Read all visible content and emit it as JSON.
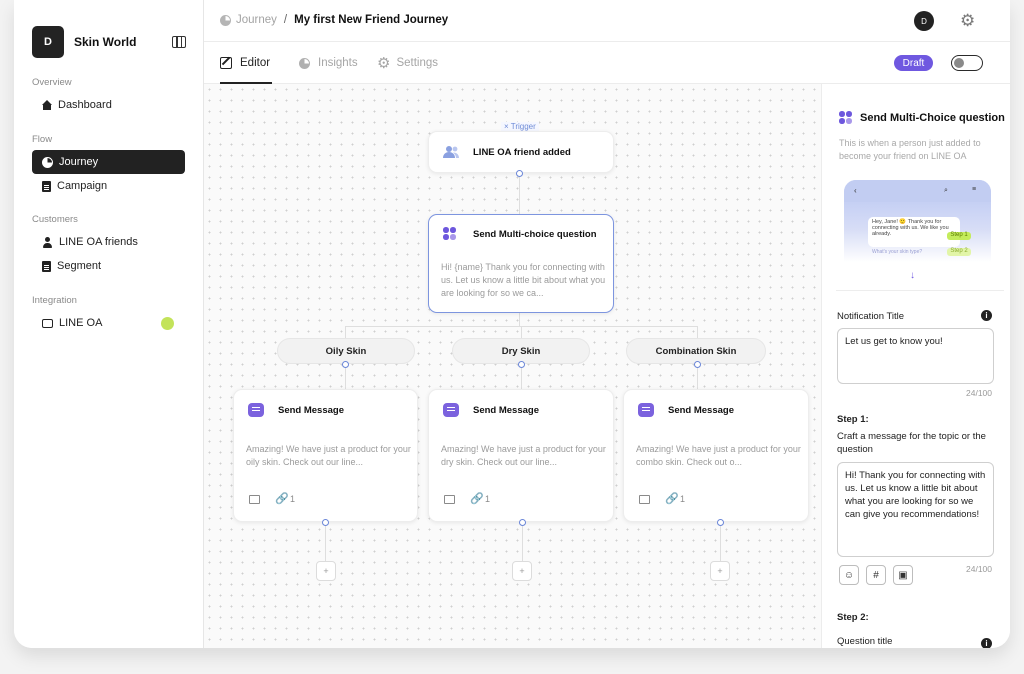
{
  "sidebar": {
    "logo_letter": "D",
    "workspace": "Skin World",
    "sections": [
      {
        "title": "Overview",
        "items": [
          {
            "label": "Dashboard",
            "icon": "home-icon"
          }
        ]
      },
      {
        "title": "Flow",
        "items": [
          {
            "label": "Journey",
            "icon": "pie-chart-icon",
            "active": true
          },
          {
            "label": "Campaign",
            "icon": "document-icon"
          }
        ]
      },
      {
        "title": "Customers",
        "items": [
          {
            "label": "LINE OA friends",
            "icon": "user-icon"
          },
          {
            "label": "Segment",
            "icon": "document-icon"
          }
        ]
      },
      {
        "title": "Integration",
        "items": [
          {
            "label": "LINE OA",
            "icon": "inbox-icon",
            "status_color": "#c3e35a"
          }
        ]
      }
    ]
  },
  "header": {
    "breadcrumb_root": "Journey",
    "breadcrumb_sep": "/",
    "breadcrumb_current": "My first New Friend Journey",
    "avatar_letter": "D"
  },
  "tabs": [
    {
      "label": "Editor",
      "active": true
    },
    {
      "label": "Insights"
    },
    {
      "label": "Settings"
    }
  ],
  "status": {
    "badge": "Draft",
    "badge_color": "#6f58e0",
    "toggle_on": false
  },
  "flow": {
    "trigger_label": "Trigger",
    "trigger_close": "×",
    "trigger_node": "LINE OA friend added",
    "question_node": {
      "title": "Send Multi-choice question",
      "body": "Hi! {name} Thank you for connecting with us. Let us know a little bit about what you are looking for so we ca..."
    },
    "branches": [
      {
        "label": "Oily Skin",
        "message_title": "Send Message",
        "message_body": "Amazing! We have just a product for your oily skin. Check out our line...",
        "link_count": "1",
        "add": "+"
      },
      {
        "label": "Dry Skin",
        "message_title": "Send Message",
        "message_body": "Amazing! We have just a product for your dry skin. Check out our line...",
        "link_count": "1",
        "add": "+"
      },
      {
        "label": "Combination Skin",
        "message_title": "Send Message",
        "message_body": "Amazing! We have just a product for your combo skin. Check out o...",
        "link_count": "1",
        "add": "+"
      }
    ]
  },
  "panel": {
    "title": "Send Multi-Choice question",
    "description": "This is when a person just added to become your friend on LINE OA",
    "preview": {
      "greeting": "Hey, Jane! 🙂 Thank you for connecting with us. We like you already.",
      "step1": "Step 1",
      "step2": "Step 2",
      "hint": "What's your skin type?"
    },
    "notification_title_label": "Notification Title",
    "notification_title_value": "Let us get to know you!",
    "notification_count": "24/100",
    "step1_label": "Step 1:",
    "step1_desc": "Craft a message for the topic or the question",
    "step1_value": "Hi! Thank you for connecting with us. Let us know a little bit about what you are looking for so we can give you recommendations!",
    "step1_count": "24/100",
    "tools": [
      "☺",
      "#",
      "▣"
    ],
    "step2_label": "Step 2:",
    "question_title_label": "Question title"
  }
}
